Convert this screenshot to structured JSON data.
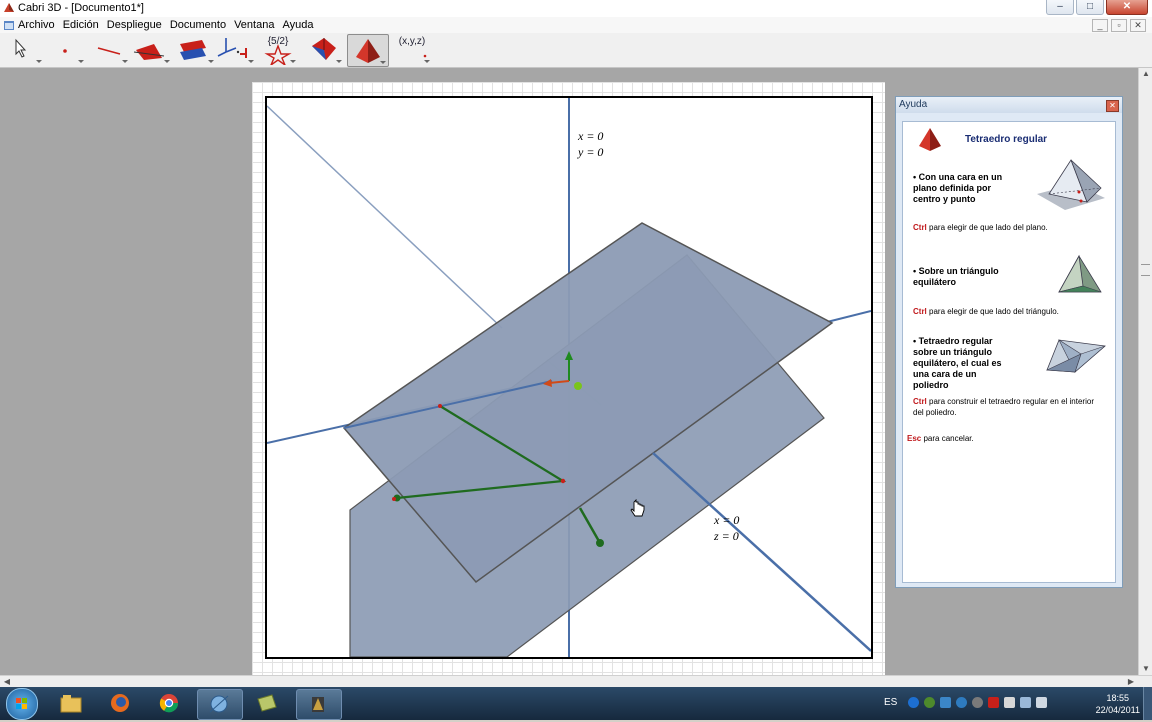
{
  "window": {
    "title": "Cabri 3D - [Documento1*]",
    "controls": {
      "minimize": "–",
      "maximize": "□",
      "close": "✕"
    }
  },
  "menu": {
    "items": [
      "Archivo",
      "Edición",
      "Despliegue",
      "Documento",
      "Ventana",
      "Ayuda"
    ],
    "mdi_controls": {
      "minimize": "_",
      "restore": "▫",
      "close": "✕"
    }
  },
  "toolbar": {
    "tools": [
      {
        "name": "manipulation",
        "icon": "arrow-pointer-icon"
      },
      {
        "name": "points",
        "icon": "point-icon"
      },
      {
        "name": "curves",
        "icon": "line-icon"
      },
      {
        "name": "surfaces",
        "icon": "plane-icon"
      },
      {
        "name": "relative-constructions",
        "icon": "parallel-planes-icon"
      },
      {
        "name": "vectors",
        "icon": "axes-icon"
      },
      {
        "name": "transformations",
        "icon": "star-transform-icon",
        "label": "{5/2}"
      },
      {
        "name": "polyhedra",
        "icon": "polyhedron-icon"
      },
      {
        "name": "regular-polyhedra",
        "icon": "tetrahedron-icon",
        "active": true
      },
      {
        "name": "measurement",
        "icon": "coordinates-icon",
        "label": "(x,y,z)"
      }
    ]
  },
  "view": {
    "labels": {
      "vertical_axis_x": "x = 0",
      "vertical_axis_y": "y = 0",
      "diagonal_axis_x": "x = 0",
      "diagonal_axis_z": "z = 0"
    },
    "colors": {
      "plane_fill": "#8c9bb4",
      "axis": "#4a6fa8",
      "segment": "#1f6b1f",
      "point": "#c8201a"
    }
  },
  "help": {
    "panel_title": "Ayuda",
    "tool_title": "Tetraedro regular",
    "sections": [
      {
        "heading_lines": [
          "• Con una cara en un",
          "plano definida por",
          "centro y punto"
        ],
        "key": "Ctrl",
        "text": " para elegir de que lado del plano."
      },
      {
        "heading_lines": [
          "• Sobre un triángulo",
          "equilátero"
        ],
        "key": "Ctrl",
        "text": " para elegir de que lado del triángulo."
      },
      {
        "heading_lines": [
          "• Tetraedro regular",
          "sobre un triángulo",
          "equilátero, el cual es",
          "una cara de un",
          "poliedro"
        ],
        "key": "Ctrl",
        "text_lines": [
          " para construir el tetraedro regular en el interior",
          "del poliedro."
        ]
      }
    ],
    "esc": {
      "key": "Esc",
      "text": " para cancelar."
    }
  },
  "taskbar": {
    "apps": [
      "windows-explorer-icon",
      "firefox-icon",
      "chrome-icon",
      "network-icon",
      "notepad-icon",
      "cabri-icon"
    ],
    "language": "ES",
    "time": "18:55",
    "date": "22/04/2011"
  }
}
